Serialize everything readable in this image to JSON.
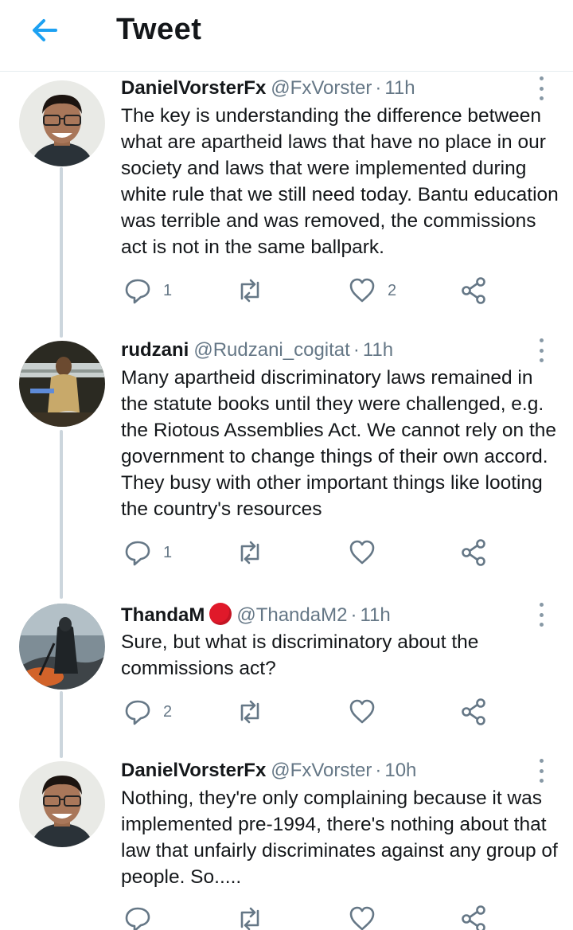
{
  "header": {
    "title": "Tweet",
    "back_icon": "arrow-left-icon",
    "accent_color": "#1da1f2"
  },
  "tweets": [
    {
      "name": "DanielVorsterFx",
      "handle": "@FxVorster",
      "separator": "·",
      "time": "11h",
      "text": "The key is understanding the difference between what are apartheid laws that have no place in our society and laws that were implemented during white rule that we still need today. Bantu education was terrible and was removed, the commissions act is not in the same ballpark.",
      "replies": "1",
      "retweets": "",
      "likes": "2"
    },
    {
      "name": "rudzani",
      "handle": "@Rudzani_cogitat",
      "separator": "·",
      "time": "11h",
      "text": "Many apartheid discriminatory laws remained in the statute books until they were challenged, e.g. the Riotous Assemblies Act. We cannot rely on the government to change things of their own accord. They busy with other important things like looting the country's resources",
      "replies": "1",
      "retweets": "",
      "likes": ""
    },
    {
      "name": "ThandaM",
      "handle": "@ThandaM2",
      "separator": "·",
      "time": "11h",
      "text": "Sure, but what is discriminatory about the commissions act?",
      "replies": "2",
      "retweets": "",
      "likes": ""
    },
    {
      "name": "DanielVorsterFx",
      "handle": "@FxVorster",
      "separator": "·",
      "time": "10h",
      "text": "Nothing, they're only complaining because it was implemented pre-1994, there's nothing about that law that unfairly discriminates against any group of people. So.....",
      "replies": "",
      "retweets": "",
      "likes": ""
    }
  ],
  "icons": {
    "reply": "reply-icon",
    "retweet": "retweet-icon",
    "like": "heart-icon",
    "share": "share-icon",
    "more": "more-vertical-icon",
    "badge": "red-circle-badge-icon"
  }
}
